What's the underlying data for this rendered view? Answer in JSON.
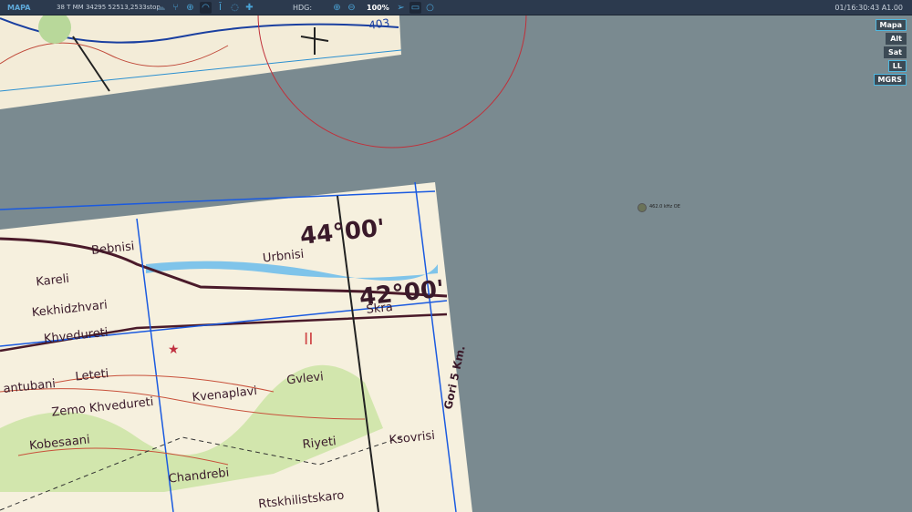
{
  "topbar": {
    "app_name": "MAPA",
    "coordinates": "38 T MM 34295 52513,2533stop",
    "icons": [
      "cloud-icon",
      "waypoint-network-icon",
      "crosshair-icon",
      "wifi-icon",
      "tower-icon",
      "chat-icon",
      "move-icon",
      "zoom-in-icon",
      "zoom-out-icon",
      "navigate-icon",
      "measure-icon",
      "circle-icon"
    ],
    "hdg_label": "HDG:",
    "zoom_level": "100%",
    "clock": "01/16:30:43 A1.00"
  },
  "side_buttons": [
    {
      "label": "Mapa",
      "active": true
    },
    {
      "label": "Alt",
      "active": false
    },
    {
      "label": "Sat",
      "active": false
    },
    {
      "label": "LL",
      "active": true
    },
    {
      "label": "MGRS",
      "active": true
    }
  ],
  "ndb": {
    "label": "462.0 kHz OE"
  },
  "map_labels": {
    "places": [
      "Bebnisi",
      "Kareli",
      "Urbnisi",
      "Kekhidzhvari",
      "Khvedureti",
      "Skra",
      "Leteti",
      "antubani",
      "Zemo Khvedureti",
      "Kvenaplavi",
      "Gvlevi",
      "Kobesaani",
      "Riyeti",
      "Chandrebi",
      "Ksovrisi",
      "Rtskhilistskaro",
      "Gori 5 Km."
    ],
    "grid": [
      "44°00'",
      "42°00'",
      "II",
      "403"
    ]
  },
  "colors": {
    "background": "#7a8a90",
    "topbar": "#2c3a4e",
    "accent": "#4fb8e0",
    "range_ring": "#c0303a"
  }
}
